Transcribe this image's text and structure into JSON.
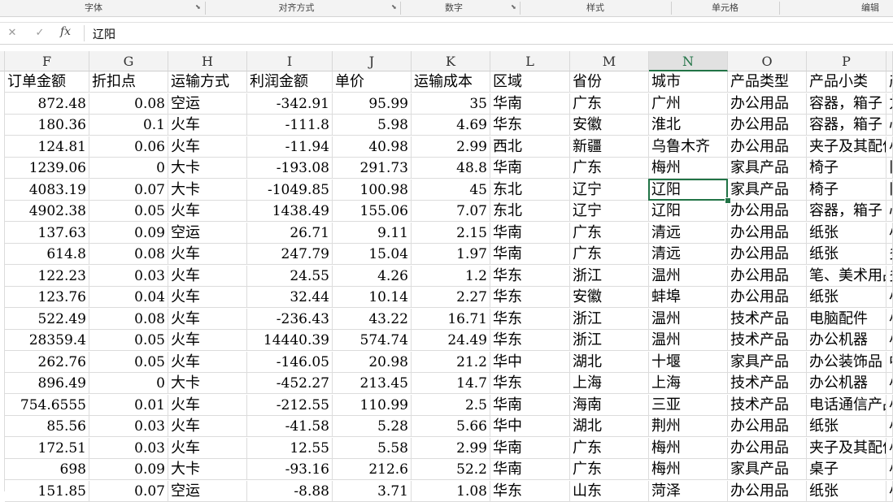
{
  "ribbon": {
    "groups": [
      "字体",
      "对齐方式",
      "数字",
      "样式",
      "单元格",
      "编辑"
    ]
  },
  "formula_bar": {
    "cancel_icon": "close-icon",
    "enter_icon": "check-icon",
    "fx_label": "fx",
    "value": "辽阳"
  },
  "columns": [
    "F",
    "G",
    "H",
    "I",
    "J",
    "K",
    "L",
    "M",
    "N",
    "O",
    "P",
    ""
  ],
  "active_column": "N",
  "headers": [
    "订单金额",
    "折扣点",
    "运输方式",
    "利润金额",
    "单价",
    "运输成本",
    "区域",
    "省份",
    "城市",
    "产品类型",
    "产品小类",
    "产"
  ],
  "rows": [
    [
      "872.48",
      "0.08",
      "空运",
      "-342.91",
      "95.99",
      "35",
      "华南",
      "广东",
      "广州",
      "办公用品",
      "容器，箱子",
      "力"
    ],
    [
      "180.36",
      "0.1",
      "火车",
      "-111.8",
      "5.98",
      "4.69",
      "华东",
      "安徽",
      "淮北",
      "办公用品",
      "容器，箱子",
      "心"
    ],
    [
      "124.81",
      "0.06",
      "火车",
      "-11.94",
      "40.98",
      "2.99",
      "西北",
      "新疆",
      "乌鲁木齐",
      "办公用品",
      "夹子及其配件",
      "小"
    ],
    [
      "1239.06",
      "0",
      "大卡",
      "-193.08",
      "291.73",
      "48.8",
      "华南",
      "广东",
      "梅州",
      "家具产品",
      "椅子",
      "旧"
    ],
    [
      "4083.19",
      "0.07",
      "大卡",
      "-1049.85",
      "100.98",
      "45",
      "东北",
      "辽宁",
      "辽阳",
      "家具产品",
      "椅子",
      "旧"
    ],
    [
      "4902.38",
      "0.05",
      "火车",
      "1438.49",
      "155.06",
      "7.07",
      "东北",
      "辽宁",
      "辽阳",
      "办公用品",
      "容器，箱子",
      "心"
    ],
    [
      "137.63",
      "0.09",
      "空运",
      "26.71",
      "9.11",
      "2.15",
      "华南",
      "广东",
      "清远",
      "办公用品",
      "纸张",
      "小"
    ],
    [
      "614.8",
      "0.08",
      "火车",
      "247.79",
      "15.04",
      "1.97",
      "华南",
      "广东",
      "清远",
      "办公用品",
      "纸张",
      "多"
    ],
    [
      "122.23",
      "0.03",
      "火车",
      "24.55",
      "4.26",
      "1.2",
      "华东",
      "浙江",
      "温州",
      "办公用品",
      "笔、美术用品",
      "多"
    ],
    [
      "123.76",
      "0.04",
      "火车",
      "32.44",
      "10.14",
      "2.27",
      "华东",
      "安徽",
      "蚌埠",
      "办公用品",
      "纸张",
      "小"
    ],
    [
      "522.49",
      "0.08",
      "火车",
      "-236.43",
      "43.22",
      "16.71",
      "华东",
      "浙江",
      "温州",
      "技术产品",
      "电脑配件",
      "小"
    ],
    [
      "28359.4",
      "0.05",
      "火车",
      "14440.39",
      "574.74",
      "24.49",
      "华东",
      "浙江",
      "温州",
      "技术产品",
      "办公机器",
      "小"
    ],
    [
      "262.76",
      "0.05",
      "火车",
      "-146.05",
      "20.98",
      "21.2",
      "华中",
      "湖北",
      "十堰",
      "家具产品",
      "办公装饰品",
      "中"
    ],
    [
      "896.49",
      "0",
      "大卡",
      "-452.27",
      "213.45",
      "14.7",
      "华东",
      "上海",
      "上海",
      "技术产品",
      "办公机器",
      "小"
    ],
    [
      "754.6555",
      "0.01",
      "火车",
      "-212.55",
      "110.99",
      "2.5",
      "华南",
      "海南",
      "三亚",
      "技术产品",
      "电话通信产品",
      "小"
    ],
    [
      "85.56",
      "0.03",
      "火车",
      "-41.58",
      "5.28",
      "5.66",
      "华中",
      "湖北",
      "荆州",
      "办公用品",
      "纸张",
      "小"
    ],
    [
      "172.51",
      "0.03",
      "火车",
      "12.55",
      "5.58",
      "2.99",
      "华南",
      "广东",
      "梅州",
      "办公用品",
      "夹子及其配件",
      "小"
    ],
    [
      "698",
      "0.09",
      "大卡",
      "-93.16",
      "212.6",
      "52.2",
      "华南",
      "广东",
      "梅州",
      "家具产品",
      "桌子",
      "小"
    ],
    [
      "151.85",
      "0.07",
      "空运",
      "-8.88",
      "3.71",
      "1.08",
      "华东",
      "山东",
      "菏泽",
      "办公用品",
      "纸张",
      "小"
    ]
  ],
  "selected_cell": {
    "row": 4,
    "col": 8
  }
}
